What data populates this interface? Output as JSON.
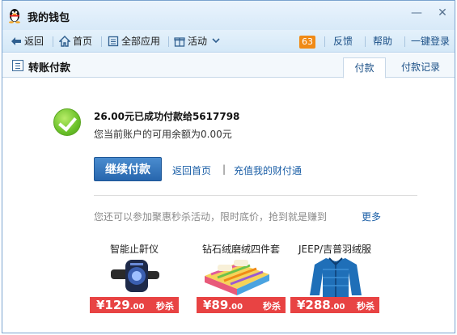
{
  "window": {
    "title": "我的钱包",
    "minimize": "—",
    "close": "✕"
  },
  "nav": {
    "back": "返回",
    "home": "首页",
    "all_apps": "全部应用",
    "activities": "活动",
    "badge_count": "63",
    "feedback": "反馈",
    "help": "帮助",
    "login": "一键登录"
  },
  "page": {
    "title": "转账付款"
  },
  "tabs": [
    {
      "label": "付款",
      "active": true
    },
    {
      "label": "付款记录",
      "active": false
    }
  ],
  "result": {
    "success_message": "26.00元已成功付款给5617798",
    "balance_message": "您当前账户的可用余额为0.00元"
  },
  "actions": {
    "continue_pay": "继续付款",
    "return_home": "返回首页",
    "separator": "|",
    "recharge": "充值我的财付通"
  },
  "promo": {
    "text": "您还可以参加聚惠秒杀活动，限时底价，抢到就是赚到",
    "more": "更多",
    "products": [
      {
        "name": "智能止鼾仪",
        "price": "¥129",
        "cents": ".00",
        "tag": "秒杀",
        "icon": "watch-device-image"
      },
      {
        "name": "钻石绒磨绒四件套",
        "price": "¥89",
        "cents": ".00",
        "tag": "秒杀",
        "icon": "bedding-image"
      },
      {
        "name": "JEEP/吉普羽绒服",
        "price": "¥288",
        "cents": ".00",
        "tag": "秒杀",
        "icon": "down-jacket-image"
      }
    ]
  },
  "colors": {
    "accent": "#2766ad",
    "price": "#e84343",
    "link": "#1a5ea6",
    "success": "#6bc12a"
  }
}
